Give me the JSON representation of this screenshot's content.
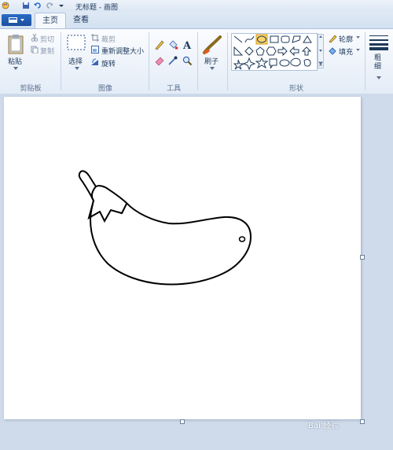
{
  "window": {
    "title": "无标题 - 画图"
  },
  "tabs": [
    {
      "label": "主页",
      "active": true
    },
    {
      "label": "查看",
      "active": false
    }
  ],
  "groups": {
    "clipboard": {
      "label": "剪贴板",
      "paste": "粘贴",
      "cut": "剪切",
      "copy": "复制"
    },
    "image": {
      "label": "图像",
      "select": "选择",
      "crop": "裁剪",
      "resize": "重新调整大小",
      "rotate": "旋转"
    },
    "tools": {
      "label": "工具"
    },
    "brushes": {
      "label": "刷子"
    },
    "shapes": {
      "label": "形状",
      "outline": "轮廓",
      "fill": "填充"
    },
    "size": {
      "label": "粗细"
    }
  },
  "watermark": "Bai 经验",
  "colors": {
    "accent": "#2b6cc4",
    "ribbon": "#e3ecf7",
    "workspace": "#cfdbeb"
  }
}
